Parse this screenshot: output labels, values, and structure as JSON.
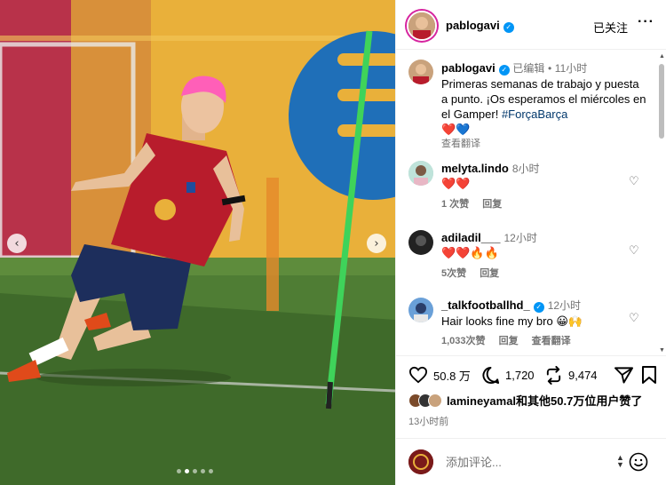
{
  "photo": {
    "prev_icon": "chevron-left-icon",
    "next_icon": "chevron-right-icon",
    "prev_glyph": "‹",
    "next_glyph": "›",
    "slide_count": 5,
    "active_slide": 2
  },
  "header": {
    "username": "pablogavi",
    "follow_label": "已关注",
    "more_label": "···"
  },
  "caption": {
    "username": "pablogavi",
    "edited": "已编辑",
    "separator": "•",
    "time": "11小时",
    "text": "Primeras semanas de trabajo y puesta a punto. ¡Os esperamos el miércoles en el Gamper!",
    "hashtag": "#ForçaBarça",
    "emoji": "❤️💙",
    "translate": "查看翻译"
  },
  "comments": [
    {
      "username": "melyta.lindo",
      "time": "8小时",
      "text": "❤️❤️",
      "likes": "1 次赞",
      "reply": "回复"
    },
    {
      "username": "adiladil___",
      "time": "12小时",
      "text": "❤️❤️🔥🔥",
      "likes": "5次赞",
      "reply": "回复"
    },
    {
      "username": "_talkfootballhd_",
      "time": "12小时",
      "text": "Hair looks fine my bro 😀🙌",
      "likes": "1,033次赞",
      "reply": "回复",
      "translate": "查看翻译"
    }
  ],
  "actions": {
    "like_count": "50.8 万",
    "comment_count": "1,720",
    "share_count": "9,474"
  },
  "likes_summary": {
    "user": "lamineyamal",
    "rest": "和其他50.7万位用户赞了"
  },
  "post_time": "13小时前",
  "composer": {
    "placeholder": "添加评论..."
  },
  "colors": {
    "accent_blue": "#0095f6",
    "hashtag": "#00376b",
    "muted": "#737373",
    "heart_red": "#e0245e"
  }
}
